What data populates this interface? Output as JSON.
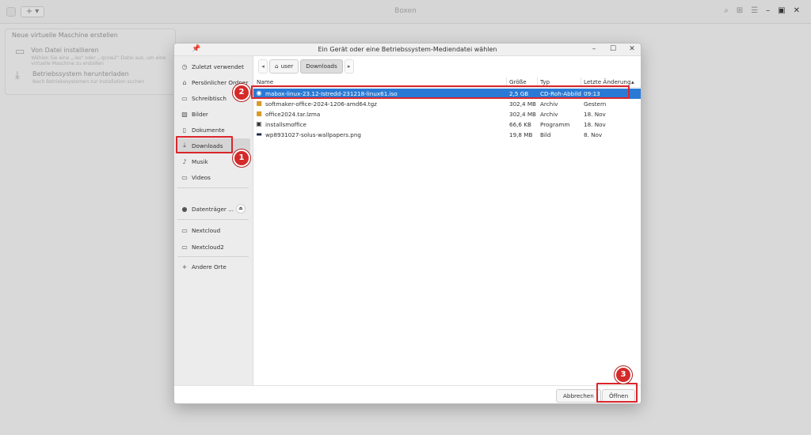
{
  "app": {
    "title": "Boxen",
    "add_label": "+ ▾",
    "panel": {
      "title": "Neue virtuelle Maschine erstellen",
      "items": [
        {
          "title": "Von Datei installieren",
          "subtitle": "Wählen Sie eine „.iso“ oder „.qcow2“-Datei aus, um eine virtuelle Maschine zu erstellen"
        },
        {
          "title": "Betriebssystem herunterladen",
          "subtitle": "Nach Betriebssystemen zur Installation suchen"
        }
      ]
    }
  },
  "dialog": {
    "title": "Ein Gerät oder eine Betriebssystem-Mediendatei wählen",
    "sidebar": [
      {
        "label": "Zuletzt verwendet",
        "icon": "clock-icon"
      },
      {
        "label": "Persönlicher Ordner",
        "icon": "home-icon"
      },
      {
        "label": "Schreibtisch",
        "icon": "desktop-icon"
      },
      {
        "label": "Bilder",
        "icon": "image-icon"
      },
      {
        "label": "Dokumente",
        "icon": "document-icon"
      },
      {
        "label": "Downloads",
        "icon": "download-icon"
      },
      {
        "label": "Musik",
        "icon": "music-icon"
      },
      {
        "label": "Videos",
        "icon": "video-icon"
      },
      {
        "label": "Datenträger ...",
        "icon": "drive-icon"
      },
      {
        "label": "Nextcloud",
        "icon": "folder-icon"
      },
      {
        "label": "Nextcloud2",
        "icon": "folder-icon"
      },
      {
        "label": "Andere Orte",
        "icon": "plus-icon"
      }
    ],
    "pathbar": {
      "home": "user",
      "current": "Downloads"
    },
    "columns": {
      "name": "Name",
      "size": "Größe",
      "type": "Typ",
      "modified": "Letzte Änderung"
    },
    "files": [
      {
        "name": "mabox-linux-23.12-Istredd-231218-linux61.iso",
        "size": "2,5 GB",
        "type": "CD-Roh-Abbild",
        "modified": "09:13",
        "icon": "disc-icon",
        "selected": true
      },
      {
        "name": "softmaker-office-2024-1206-amd64.tgz",
        "size": "302,4 MB",
        "type": "Archiv",
        "modified": "Gestern",
        "icon": "archive-icon"
      },
      {
        "name": "office2024.tar.lzma",
        "size": "302,4 MB",
        "type": "Archiv",
        "modified": "18. Nov",
        "icon": "archive-icon"
      },
      {
        "name": "installsmoffice",
        "size": "66,6 KB",
        "type": "Programm",
        "modified": "18. Nov",
        "icon": "executable-icon"
      },
      {
        "name": "wp8931027-solus-wallpapers.png",
        "size": "19,8 MB",
        "type": "Bild",
        "modified": "8. Nov",
        "icon": "image-file-icon"
      }
    ],
    "buttons": {
      "cancel": "Abbrechen",
      "open": "Öffnen"
    }
  },
  "annotations": [
    "1",
    "2",
    "3"
  ],
  "colors": {
    "selection": "#2a7ad5",
    "annotation": "#d9262c"
  }
}
